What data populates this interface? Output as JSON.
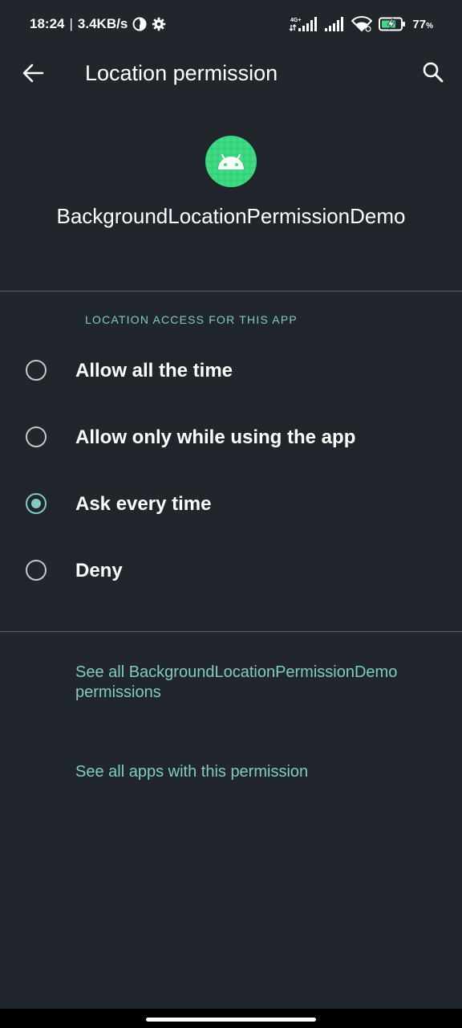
{
  "status_bar": {
    "time": "18:24",
    "separator": "|",
    "network_speed": "3.4KB/s",
    "network_type": "4G+",
    "battery_percent": "77",
    "battery_unit": "%",
    "icons": [
      "data-saver-icon",
      "settings-gear-icon",
      "signal-4g-icon",
      "signal-icon",
      "wifi-icon",
      "battery-charging-icon"
    ]
  },
  "toolbar": {
    "back_icon": "arrow-back-icon",
    "title": "Location permission",
    "search_icon": "search-icon"
  },
  "app": {
    "icon": "android-app-icon",
    "name": "BackgroundLocationPermissionDemo"
  },
  "permission": {
    "section_header": "LOCATION ACCESS FOR THIS APP",
    "options": [
      {
        "label": "Allow all the time",
        "selected": false
      },
      {
        "label": "Allow only while using the app",
        "selected": false
      },
      {
        "label": "Ask every time",
        "selected": true
      },
      {
        "label": "Deny",
        "selected": false
      }
    ]
  },
  "links": {
    "see_all_permissions": "See all BackgroundLocationPermissionDemo permissions",
    "see_all_apps": "See all apps with this permission"
  },
  "colors": {
    "background": "#21262c",
    "accent": "#80cbc4",
    "text_primary": "#ffffff",
    "divider": "#5c6066",
    "app_icon_green": "#3ddc84"
  }
}
